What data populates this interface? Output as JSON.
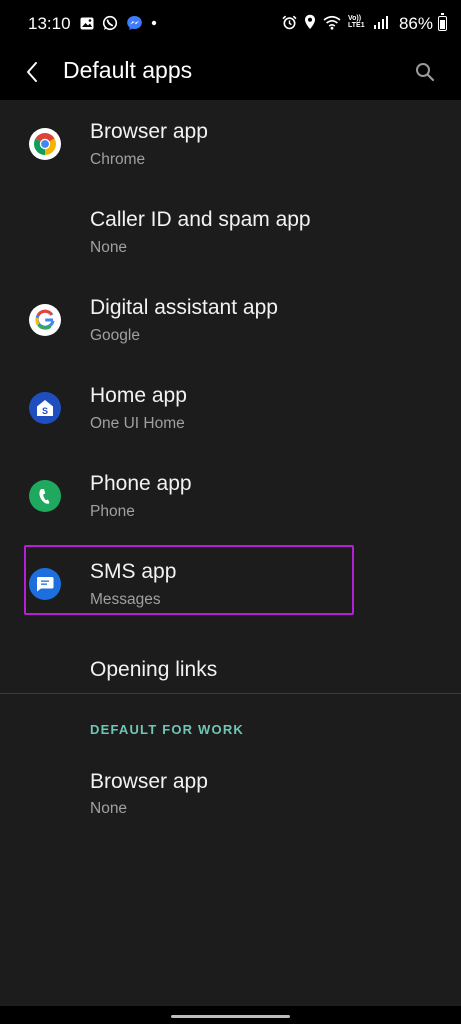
{
  "status_bar": {
    "time": "13:10",
    "network_label": "Vo)) LTE1",
    "battery_percent": "86%",
    "left_icons": [
      "gallery-icon",
      "whatsapp-icon",
      "messenger-icon",
      "dot-icon"
    ],
    "right_icons": [
      "alarm-icon",
      "location-icon",
      "wifi-icon",
      "volte-icon",
      "signal-icon"
    ]
  },
  "app_bar": {
    "title": "Default apps",
    "back_icon": "back-arrow-icon",
    "search_icon": "search-icon"
  },
  "items": [
    {
      "label": "Browser app",
      "value": "Chrome",
      "icon": "chrome-icon"
    },
    {
      "label": "Caller ID and spam app",
      "value": "None",
      "icon": ""
    },
    {
      "label": "Digital assistant app",
      "value": "Google",
      "icon": "google-icon"
    },
    {
      "label": "Home app",
      "value": "One UI Home",
      "icon": "one-ui-home-icon"
    },
    {
      "label": "Phone app",
      "value": "Phone",
      "icon": "phone-icon"
    },
    {
      "label": "SMS app",
      "value": "Messages",
      "icon": "messages-icon"
    },
    {
      "label": "Opening links"
    }
  ],
  "work_section": {
    "header": "DEFAULT FOR WORK",
    "items": [
      {
        "label": "Browser app",
        "value": "None"
      }
    ]
  },
  "colors": {
    "background": "#1c1c1c",
    "bar_background": "#000000",
    "section_header": "#6fc6b5",
    "highlight_border": "#b51fd6",
    "secondary_text": "#a0a0a0"
  }
}
